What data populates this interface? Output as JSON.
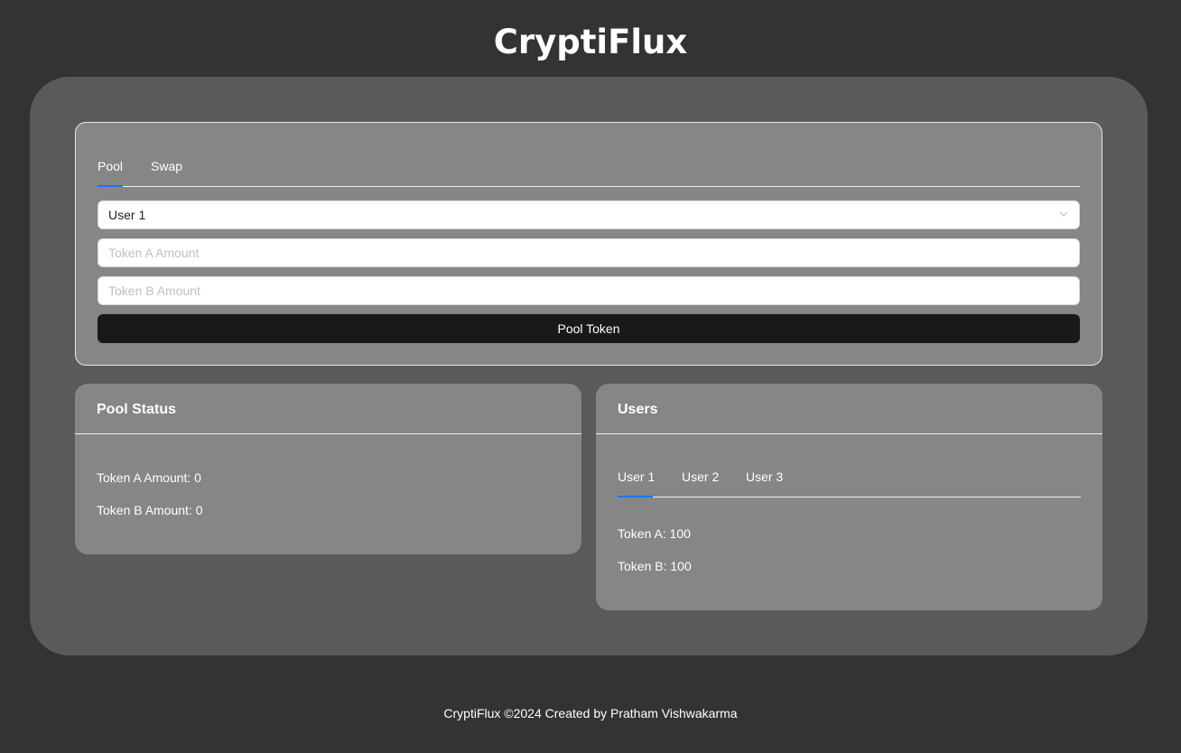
{
  "header": {
    "title": "CryptiFlux"
  },
  "form": {
    "tabs": [
      {
        "label": "Pool",
        "active": true
      },
      {
        "label": "Swap",
        "active": false
      }
    ],
    "user_select": {
      "value": "User 1"
    },
    "token_a_input": {
      "value": "",
      "placeholder": "Token A Amount"
    },
    "token_b_input": {
      "value": "",
      "placeholder": "Token B Amount"
    },
    "submit_label": "Pool Token"
  },
  "pool_status": {
    "title": "Pool Status",
    "token_a": "Token A Amount: 0",
    "token_b": "Token B Amount: 0"
  },
  "users": {
    "title": "Users",
    "tabs": [
      {
        "label": "User 1",
        "active": true
      },
      {
        "label": "User 2",
        "active": false
      },
      {
        "label": "User 3",
        "active": false
      }
    ],
    "token_a": "Token A: 100",
    "token_b": "Token B: 100"
  },
  "footer": {
    "text": "CryptiFlux ©2024 Created by Pratham Vishwakarma"
  },
  "colors": {
    "background": "#333333",
    "panel": "#5a5a5a",
    "card": "#868686",
    "accent": "#1677ff",
    "button": "#191919"
  }
}
